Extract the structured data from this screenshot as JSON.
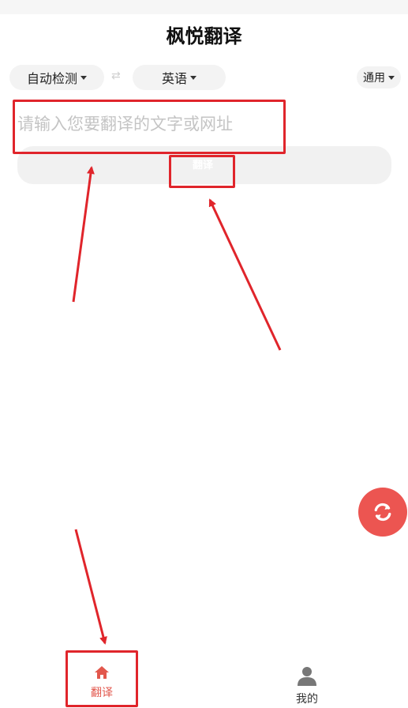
{
  "app": {
    "title": "枫悦翻译"
  },
  "lang_bar": {
    "source": "自动检测",
    "swap_symbol": "⇄",
    "target": "英语",
    "domain": "通用"
  },
  "input": {
    "placeholder": "请输入您要翻译的文字或网址"
  },
  "translate": {
    "label": "翻译"
  },
  "tabbar": {
    "items": [
      {
        "label": "翻译",
        "icon": "home-icon",
        "active": true
      },
      {
        "label": "我的",
        "icon": "user-icon",
        "active": false
      }
    ]
  },
  "fab": {
    "icon": "refresh-icon"
  },
  "colors": {
    "accent": "#e2574c",
    "annotation": "#e0252b",
    "fab": "#ec5551"
  }
}
